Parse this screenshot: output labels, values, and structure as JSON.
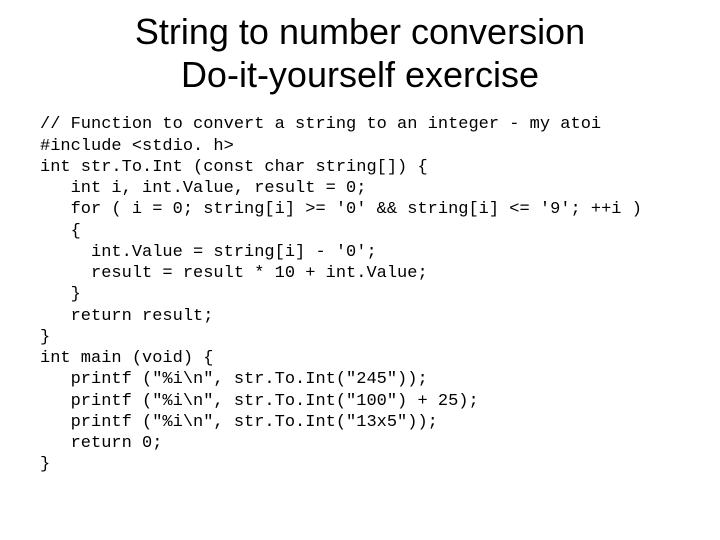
{
  "title_line1": "String to number conversion",
  "title_line2": "Do-it-yourself exercise",
  "code": "// Function to convert a string to an integer - my atoi\n#include <stdio. h>\nint str.To.Int (const char string[]) {\n   int i, int.Value, result = 0;\n   for ( i = 0; string[i] >= '0' && string[i] <= '9'; ++i )\n   {\n     int.Value = string[i] - '0';\n     result = result * 10 + int.Value;\n   }\n   return result;\n}\nint main (void) {\n   printf (\"%i\\n\", str.To.Int(\"245\"));\n   printf (\"%i\\n\", str.To.Int(\"100\") + 25);\n   printf (\"%i\\n\", str.To.Int(\"13x5\"));\n   return 0;\n}"
}
